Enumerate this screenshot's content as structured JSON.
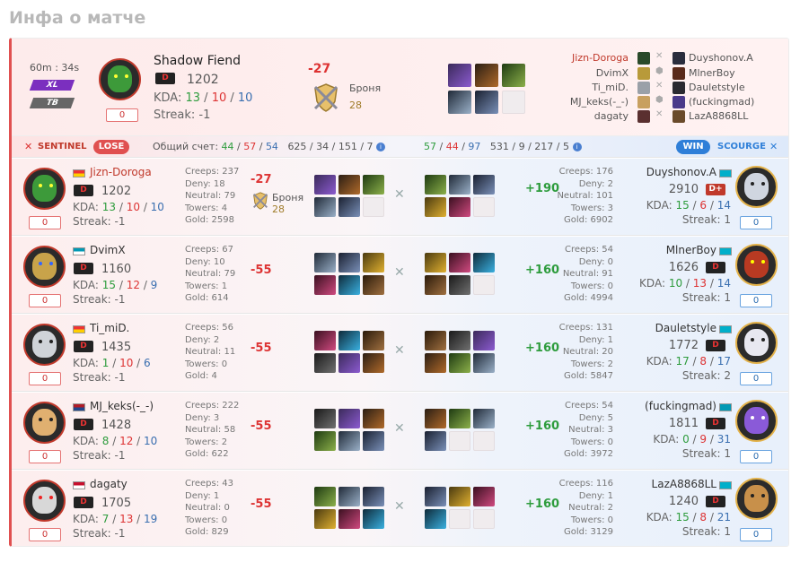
{
  "title": "Инфа о матче",
  "header": {
    "duration": "60m : 34s",
    "tags": [
      "XL",
      "TB"
    ],
    "hero_zero": "0",
    "hero_name": "Shadow Fiend",
    "rank": "D",
    "mmr": "1202",
    "kda_label": "KDA:",
    "kda": [
      "13",
      "10",
      "10"
    ],
    "streak": "Streak: -1",
    "delta": "-27",
    "armor_label": "Броня",
    "armor_value": "28",
    "players": [
      {
        "left": "Jizn-Doroga",
        "right": "Duyshonov.A"
      },
      {
        "left": "DvimX",
        "right": "MlnerBoy"
      },
      {
        "left": "Ti_miD.",
        "right": "Dauletstyle"
      },
      {
        "left": "MJ_keks(-_-)",
        "right": "(fuckingmad)"
      },
      {
        "left": "dagaty",
        "right": "LazA8868LL"
      }
    ]
  },
  "scorebar": {
    "sentinel": "SENTINEL",
    "lose": "LOSE",
    "total_label": "Общий счет:",
    "left_kda": [
      "44",
      "57",
      "54"
    ],
    "left_extra": "625 / 34 / 151 / 7",
    "right_kda": [
      "57",
      "44",
      "97"
    ],
    "right_extra": "531 / 9 / 217 / 5",
    "win": "WIN",
    "scourge": "SCOURGE"
  },
  "rows": [
    {
      "lname": "Jizn-Doroga",
      "lrank": "D",
      "lmmr": "1202",
      "lkda": [
        "13",
        "10",
        "10"
      ],
      "lstreak": "Streak: -1",
      "lzero": "0",
      "lstats": [
        "Creeps: 237",
        "Deny: 18",
        "Neutral: 79",
        "Towers: 4",
        "Gold: 2598"
      ],
      "ldelta": "-27",
      "armor": "Броня",
      "armor_val": "28",
      "rdelta": "+190",
      "rstats": [
        "Creeps: 176",
        "Deny: 2",
        "Neutral: 101",
        "Towers: 3",
        "Gold: 6902"
      ],
      "rname": "Duyshonov.A",
      "rrank": "D+",
      "rmmr": "2910",
      "rkda": [
        "15",
        "6",
        "14"
      ],
      "rstreak": "Streak: 1",
      "rzero": "0"
    },
    {
      "lname": "DvimX",
      "lrank": "D",
      "lmmr": "1160",
      "lkda": [
        "15",
        "12",
        "9"
      ],
      "lstreak": "Streak: -1",
      "lzero": "0",
      "lstats": [
        "Creeps: 67",
        "Deny: 10",
        "Neutral: 79",
        "Towers: 1",
        "Gold: 614"
      ],
      "ldelta": "-55",
      "rdelta": "+160",
      "rstats": [
        "Creeps: 54",
        "Deny: 0",
        "Neutral: 91",
        "Towers: 0",
        "Gold: 4994"
      ],
      "rname": "MlnerBoy",
      "rrank": "D",
      "rmmr": "1626",
      "rkda": [
        "10",
        "13",
        "14"
      ],
      "rstreak": "Streak: 1",
      "rzero": "0"
    },
    {
      "lname": "Ti_miD.",
      "lrank": "D",
      "lmmr": "1435",
      "lkda": [
        "1",
        "10",
        "6"
      ],
      "lstreak": "Streak: -1",
      "lzero": "0",
      "lstats": [
        "Creeps: 56",
        "Deny: 2",
        "Neutral: 11",
        "Towers: 0",
        "Gold: 4"
      ],
      "ldelta": "-55",
      "rdelta": "+160",
      "rstats": [
        "Creeps: 131",
        "Deny: 1",
        "Neutral: 20",
        "Towers: 2",
        "Gold: 5847"
      ],
      "rname": "Dauletstyle",
      "rrank": "D",
      "rmmr": "1772",
      "rkda": [
        "17",
        "8",
        "17"
      ],
      "rstreak": "Streak: 2",
      "rzero": "0"
    },
    {
      "lname": "MJ_keks(-_-)",
      "lrank": "D",
      "lmmr": "1428",
      "lkda": [
        "8",
        "12",
        "10"
      ],
      "lstreak": "Streak: -1",
      "lzero": "0",
      "lstats": [
        "Creeps: 222",
        "Deny: 3",
        "Neutral: 58",
        "Towers: 2",
        "Gold: 622"
      ],
      "ldelta": "-55",
      "rdelta": "+160",
      "rstats": [
        "Creeps: 54",
        "Deny: 5",
        "Neutral: 3",
        "Towers: 0",
        "Gold: 3972"
      ],
      "rname": "(fuckingmad)",
      "rrank": "D",
      "rmmr": "1811",
      "rkda": [
        "0",
        "9",
        "31"
      ],
      "rstreak": "Streak: 1",
      "rzero": "0"
    },
    {
      "lname": "dagaty",
      "lrank": "D",
      "lmmr": "1705",
      "lkda": [
        "7",
        "13",
        "19"
      ],
      "lstreak": "Streak: -1",
      "lzero": "0",
      "lstats": [
        "Creeps: 43",
        "Deny: 1",
        "Neutral: 0",
        "Towers: 0",
        "Gold: 829"
      ],
      "ldelta": "-55",
      "rdelta": "+160",
      "rstats": [
        "Creeps: 116",
        "Deny: 1",
        "Neutral: 2",
        "Towers: 0",
        "Gold: 3129"
      ],
      "rname": "LazA8868LL",
      "rrank": "D",
      "rmmr": "1240",
      "rkda": [
        "15",
        "8",
        "21"
      ],
      "rstreak": "Streak: 1",
      "rzero": "0"
    }
  ],
  "colors": {
    "accent_red": "#d33",
    "green": "#2e9c3d",
    "blue": "#3a6fb0",
    "win_blue": "#2f7fd8",
    "tag_purple": "#7b2fbf"
  }
}
